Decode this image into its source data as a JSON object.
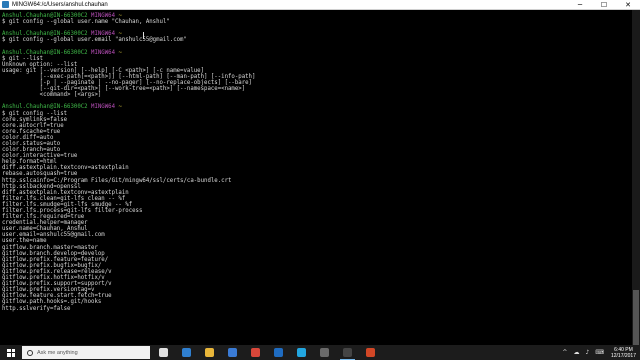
{
  "window": {
    "title": "MINGW64:/c/Users/anshul.chauhan",
    "minimize": "─",
    "maximize": "☐",
    "close": "✕"
  },
  "terminal": {
    "lines": [
      [
        {
          "t": "Anshul.Chauhan@IN-66300C2 ",
          "c": "prompt"
        },
        {
          "t": "MINGW64 ",
          "c": "mingw"
        },
        {
          "t": "~",
          "c": "path"
        }
      ],
      [
        {
          "t": "$ git config --global user.name \"Chauhan, Anshul\""
        }
      ],
      [
        {
          "t": ""
        }
      ],
      [
        {
          "t": "Anshul.Chauhan@IN-66300C2 ",
          "c": "prompt"
        },
        {
          "t": "MINGW64 ",
          "c": "mingw"
        },
        {
          "t": "~",
          "c": "path"
        }
      ],
      [
        {
          "t": "$ git config --global user.email \"anshulc55@gmail.com\""
        }
      ],
      [
        {
          "t": ""
        }
      ],
      [
        {
          "t": "Anshul.Chauhan@IN-66300C2 ",
          "c": "prompt"
        },
        {
          "t": "MINGW64 ",
          "c": "mingw"
        },
        {
          "t": "~",
          "c": "path"
        }
      ],
      [
        {
          "t": "$ git --list"
        }
      ],
      [
        {
          "t": "Unknown option: --list"
        }
      ],
      [
        {
          "t": "usage: git [--version] [--help] [-C <path>] [-c name=value]"
        }
      ],
      [
        {
          "t": "           [--exec-path[=<path>]] [--html-path] [--man-path] [--info-path]"
        }
      ],
      [
        {
          "t": "           [-p | --paginate | --no-pager] [--no-replace-objects] [--bare]"
        }
      ],
      [
        {
          "t": "           [--git-dir=<path>] [--work-tree=<path>] [--namespace=<name>]"
        }
      ],
      [
        {
          "t": "           <command> [<args>]"
        }
      ],
      [
        {
          "t": ""
        }
      ],
      [
        {
          "t": "Anshul.Chauhan@IN-66300C2 ",
          "c": "prompt"
        },
        {
          "t": "MINGW64 ",
          "c": "mingw"
        },
        {
          "t": "~",
          "c": "path"
        }
      ],
      [
        {
          "t": "$ git config --list"
        }
      ],
      [
        {
          "t": "core.symlinks=false"
        }
      ],
      [
        {
          "t": "core.autocrlf=true"
        }
      ],
      [
        {
          "t": "core.fscache=true"
        }
      ],
      [
        {
          "t": "color.diff=auto"
        }
      ],
      [
        {
          "t": "color.status=auto"
        }
      ],
      [
        {
          "t": "color.branch=auto"
        }
      ],
      [
        {
          "t": "color.interactive=true"
        }
      ],
      [
        {
          "t": "help.format=html"
        }
      ],
      [
        {
          "t": "diff.astextplain.textconv=astextplain"
        }
      ],
      [
        {
          "t": "rebase.autosquash=true"
        }
      ],
      [
        {
          "t": "http.sslcainfo=C:/Program Files/Git/mingw64/ssl/certs/ca-bundle.crt"
        }
      ],
      [
        {
          "t": "http.sslbackend=openssl"
        }
      ],
      [
        {
          "t": "diff.astextplain.textconv=astextplain"
        }
      ],
      [
        {
          "t": "filter.lfs.clean=git-lfs clean -- %f"
        }
      ],
      [
        {
          "t": "filter.lfs.smudge=git-lfs smudge -- %f"
        }
      ],
      [
        {
          "t": "filter.lfs.process=git-lfs filter-process"
        }
      ],
      [
        {
          "t": "filter.lfs.required=true"
        }
      ],
      [
        {
          "t": "credential.helper=manager"
        }
      ],
      [
        {
          "t": "user.name=Chauhan, Anshul"
        }
      ],
      [
        {
          "t": "user.email=anshulc55@gmail.com"
        }
      ],
      [
        {
          "t": "user.the=name"
        }
      ],
      [
        {
          "t": "gitflow.branch.master=master"
        }
      ],
      [
        {
          "t": "gitflow.branch.develop=develop"
        }
      ],
      [
        {
          "t": "gitflow.prefix.feature=feature/"
        }
      ],
      [
        {
          "t": "gitflow.prefix.bugfix=bugfix/"
        }
      ],
      [
        {
          "t": "gitflow.prefix.release=release/v"
        }
      ],
      [
        {
          "t": "gitflow.prefix.hotfix=hotfix/v"
        }
      ],
      [
        {
          "t": "gitflow.prefix.support=support/v"
        }
      ],
      [
        {
          "t": "gitflow.prefix.versiontag=v"
        }
      ],
      [
        {
          "t": "gitflow.feature.start.fetch=true"
        }
      ],
      [
        {
          "t": "gitflow.path.hooks=.git/hooks"
        }
      ],
      [
        {
          "t": "http.sslverify=false"
        }
      ]
    ]
  },
  "taskbar": {
    "search_placeholder": "Ask me anything",
    "apps": [
      {
        "name": "task-view-icon",
        "color": "#e0e0e0"
      },
      {
        "name": "edge-icon",
        "color": "#2f7fd0"
      },
      {
        "name": "file-explorer-icon",
        "color": "#e8b63a"
      },
      {
        "name": "store-icon",
        "color": "#3a7bd5"
      },
      {
        "name": "chrome-icon",
        "color": "#d9473a"
      },
      {
        "name": "outlook-icon",
        "color": "#1f6cc2"
      },
      {
        "name": "skype-icon",
        "color": "#22a6e0"
      },
      {
        "name": "photos-icon",
        "color": "#6a6a6a"
      },
      {
        "name": "git-bash-icon",
        "color": "#444444"
      },
      {
        "name": "powerpoint-icon",
        "color": "#d24726"
      }
    ],
    "active_app_index": 8,
    "tray_icons": [
      "^",
      "☁",
      "♪",
      "⌨"
    ],
    "time": "6:40 PM",
    "date": "12/17/2017"
  }
}
